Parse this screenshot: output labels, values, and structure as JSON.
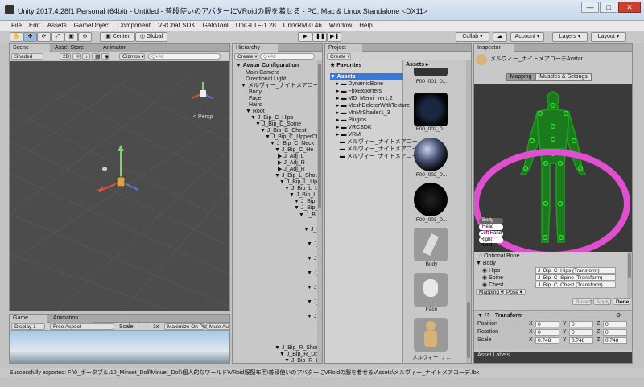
{
  "window": {
    "title": "Unity 2017.4.28f1 Personal (64bit) - Untitled - 普段使いのアバターにVRoidの服を着せる - PC, Mac & Linux Standalone <DX11>",
    "min": "—",
    "max": "□",
    "close": "✕"
  },
  "menu": [
    "File",
    "Edit",
    "Assets",
    "GameObject",
    "Component",
    "VRChat SDK",
    "GatoTool",
    "UniGLTF-1.28",
    "UniVRM-0.46",
    "Window",
    "Help"
  ],
  "toolbar": {
    "center": "Center",
    "global": "Global",
    "collab": "Collab ▾",
    "account": "Account ▾",
    "layers": "Layers ▾",
    "layout": "Layout ▾"
  },
  "scene": {
    "tabs": [
      "Scene",
      "Asset Store",
      "Animator"
    ],
    "shaded": "Shaded",
    "mode2d": "2D",
    "gizmos": "Gizmos ▾",
    "search": "Q▾All",
    "persp": "< Persp"
  },
  "game": {
    "tabs": [
      "Game",
      "Animation"
    ],
    "display": "Display 1",
    "aspect": "Free Aspect",
    "scale": "Scale",
    "scale_val": "1x",
    "maximize": "Maximize On Play",
    "mute": "Mute Audio"
  },
  "hierarchy": {
    "tab": "Hierarchy",
    "create": "Create ▾",
    "search": "Q▾All",
    "items": [
      "▼ Avatar Configuration",
      "Main Camera",
      "Directional Light",
      "▼ メルヴィー_ナイトメアコーデ(Cl",
      "Body",
      "Face",
      "Hairs",
      "▼ Root",
      "▼ J_Bip_C_Hips",
      "▼ J_Bip_C_Spine",
      "▼ J_Bip_C_Chest",
      "▼ J_Bip_C_UpperCh",
      "▼ J_Bip_C_Neck",
      "▼ J_Bip_C_He",
      "▶ J_Adj_L",
      "▶ J_Adj_R",
      "▶ J_Adj_R",
      "▼ J_Bip_L_Should",
      "▼ J_Bip_L_Upp",
      "▼ J_Bip_L_L",
      "▼ J_Bip_L",
      "▼ J_Bip_",
      "▼ J_Bip_",
      "▼ J_Bi",
      "▼ J_I",
      "▼ J_",
      "▼ J_",
      "▼ J_",
      "▼ J_",
      "▼ J_",
      "▼ J_",
      "▼ J_Bip_R_Should",
      "▼ J_Bip_R_Upp",
      "▼ J_Bip_R_L"
    ]
  },
  "project": {
    "tab": "Project",
    "create": "Create ▾",
    "favorites": "★ Favorites",
    "assets_header": "Assets ▸",
    "tree": [
      "▼ Assets",
      "DynamicBone",
      "FbxExporters",
      "MD_Mervi_ver1.2",
      "MeshDeleterWithTexture",
      "MnMrShader1_3",
      "Plugins",
      "VRCSDK",
      "VRM",
      "メルヴィー_ナイトメアコー",
      "メルヴィー_ナイトメアコー",
      "メルヴィー_ナイトメアコー"
    ],
    "thumbs": [
      "F00_001_0...",
      "F00_002_0...",
      "F00_002_0...",
      "F00_003_0...",
      "Body",
      "Face",
      "メルヴィー_ナ..."
    ]
  },
  "inspector": {
    "tab": "Inspector",
    "avatar_name": "メルヴィー_ナイトメアコーデAvatar",
    "mapping_tab": "Mapping",
    "muscles_tab": "Muscles & Settings",
    "groups": [
      "Body",
      "Head",
      "Left Hand",
      "Right Hand"
    ],
    "optional_bone": "Optional Bone",
    "body_header": "▼ Body",
    "bones": [
      {
        "name": "Hips",
        "value": "J_Bip_C_Hips (Transform)"
      },
      {
        "name": "Spine",
        "value": "J_Bip_C_Spine (Transform)"
      },
      {
        "name": "Chest",
        "value": "J_Bip_C_Chest (Transform)"
      }
    ],
    "mapping_btn": "Mapping ▾",
    "pose_btn": "Pose ▾",
    "revert": "Revert",
    "apply": "Apply",
    "done": "Done",
    "transform": {
      "title": "Transform",
      "position": "Position",
      "rotation": "Rotation",
      "scale": "Scale",
      "pos": {
        "x": "0",
        "y": "0",
        "z": "0"
      },
      "rot": {
        "x": "0",
        "y": "0",
        "z": "0"
      },
      "scl": {
        "x": "0.748",
        "y": "0.748",
        "z": "0.748"
      }
    },
    "asset_labels": "Asset Labels"
  },
  "status": "Successfully exported: F:\\0_ポータブル\\10_Minuet_Doll\\Minuet_Doll\\個人的なワールド\\VRoid服配布用\\普段使いのアバターにVRoidの服を着せる\\Assets\\メルヴィー_ナイトメアコーデ.fbx",
  "colors": {
    "accent": "#3a78d6",
    "highlight": "#e04fcf",
    "bone": "#22dd22",
    "scene_bg": "#4a4a4a",
    "sky": "#8fb6d8"
  }
}
